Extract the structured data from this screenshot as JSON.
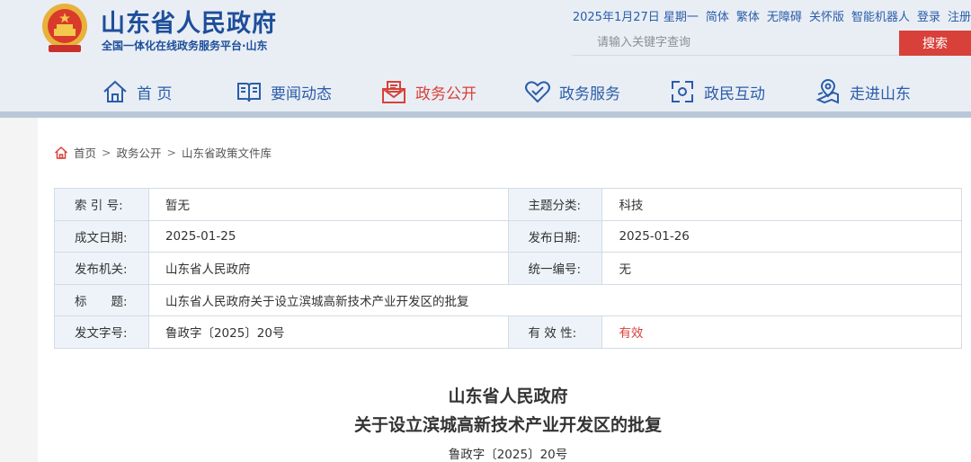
{
  "header": {
    "site_title": "山东省人民政府",
    "site_subtitle": "全国一体化在线政务服务平台·山东",
    "top_links": [
      "2025年1月27日 星期一",
      "简体",
      "繁体",
      "无障碍",
      "关怀版",
      "智能机器人",
      "登录",
      "注册"
    ],
    "search_placeholder": "请输入关键字查询",
    "search_button": "搜索"
  },
  "nav": {
    "home": "首 页",
    "news": "要闻动态",
    "gov_public": "政务公开",
    "gov_service": "政务服务",
    "interaction": "政民互动",
    "about": "走进山东"
  },
  "breadcrumb": [
    "首页",
    "政务公开",
    "山东省政策文件库"
  ],
  "meta": {
    "rows": [
      {
        "k1": "索 引 号:",
        "v1": "暂无",
        "k2": "主题分类:",
        "v2": "科技"
      },
      {
        "k1": "成文日期:",
        "v1": "2025-01-25",
        "k2": "发布日期:",
        "v2": "2025-01-26"
      },
      {
        "k1": "发布机关:",
        "v1": "山东省人民政府",
        "k2": "统一编号:",
        "v2": "无"
      },
      {
        "k1": "标　　题:",
        "v1": "山东省人民政府关于设立滨城高新技术产业开发区的批复"
      },
      {
        "k1": "发文字号:",
        "v1": "鲁政字〔2025〕20号",
        "k2": "有 效 性:",
        "v2": "有效"
      }
    ]
  },
  "document": {
    "title_line1": "山东省人民政府",
    "title_line2": "关于设立滨城高新技术产业开发区的批复",
    "number": "鲁政字〔2025〕20号"
  },
  "colors": {
    "brand_blue": "#1e4e9a",
    "accent_red": "#d8413a",
    "header_bg": "#e9eef5"
  }
}
